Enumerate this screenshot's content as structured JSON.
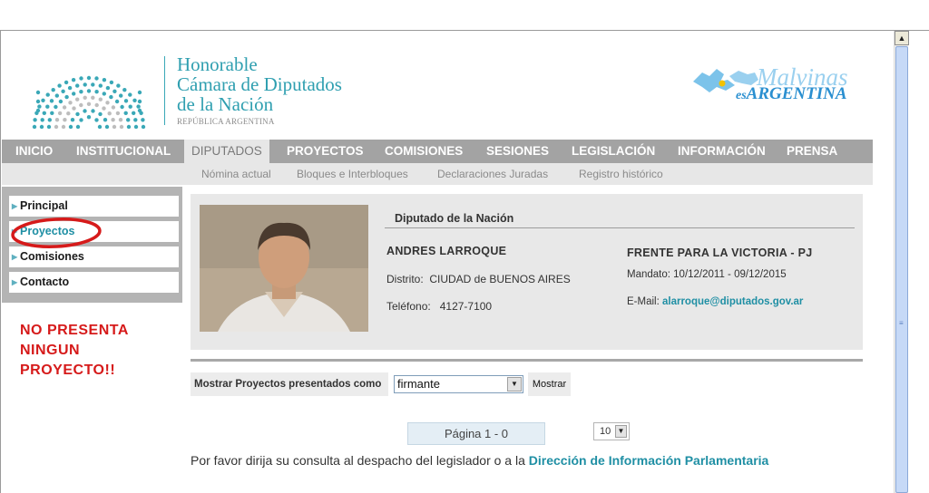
{
  "header": {
    "chamber_lines": [
      "Honorable",
      "Cámara de Diputados",
      "de la Nación"
    ],
    "republic": "REPÚBLICA ARGENTINA",
    "campaign_line1": "Malvinas",
    "campaign_es": "es",
    "campaign_line2": "ARGENTINA"
  },
  "nav": {
    "items": [
      "INICIO",
      "INSTITUCIONAL",
      "DIPUTADOS",
      "PROYECTOS",
      "COMISIONES",
      "SESIONES",
      "LEGISLACIÓN",
      "INFORMACIÓN",
      "PRENSA"
    ],
    "active": "DIPUTADOS"
  },
  "subnav": {
    "items": [
      "Nómina actual",
      "Bloques e Interbloques",
      "Declaraciones Juradas",
      "Registro histórico"
    ]
  },
  "sidebar": {
    "items": [
      "Principal",
      "Proyectos",
      "Comisiones",
      "Contacto"
    ],
    "current": "Proyectos"
  },
  "annotation": {
    "lines": [
      "NO PRESENTA",
      "NINGUN",
      "PROYECTO!!"
    ]
  },
  "profile": {
    "title": "Diputado de la Nación",
    "name": "ANDRES LARROQUE",
    "district_label": "Distrito:",
    "district": "CIUDAD de BUENOS AIRES",
    "phone_label": "Teléfono:",
    "phone": "4127-7100",
    "party": "FRENTE PARA LA VICTORIA - PJ",
    "mandate_label": "Mandato:",
    "mandate": "10/12/2011 - 09/12/2015",
    "email_label": "E-Mail:",
    "email": "alarroque@diputados.gov.ar"
  },
  "filter": {
    "label": "Mostrar Proyectos presentados como",
    "selected": "firmante",
    "button": "Mostrar"
  },
  "pagination": {
    "label": "Página 1 - 0",
    "page_size": "10"
  },
  "footer": {
    "note": "Por favor dirija su consulta al despacho del legislador o a la",
    "link": "Dirección de Información Parlamentaria"
  },
  "colors": {
    "accent_teal": "#2f9fb0",
    "nav_gray": "#a3a3a3",
    "annotation_red": "#d61a1a"
  }
}
